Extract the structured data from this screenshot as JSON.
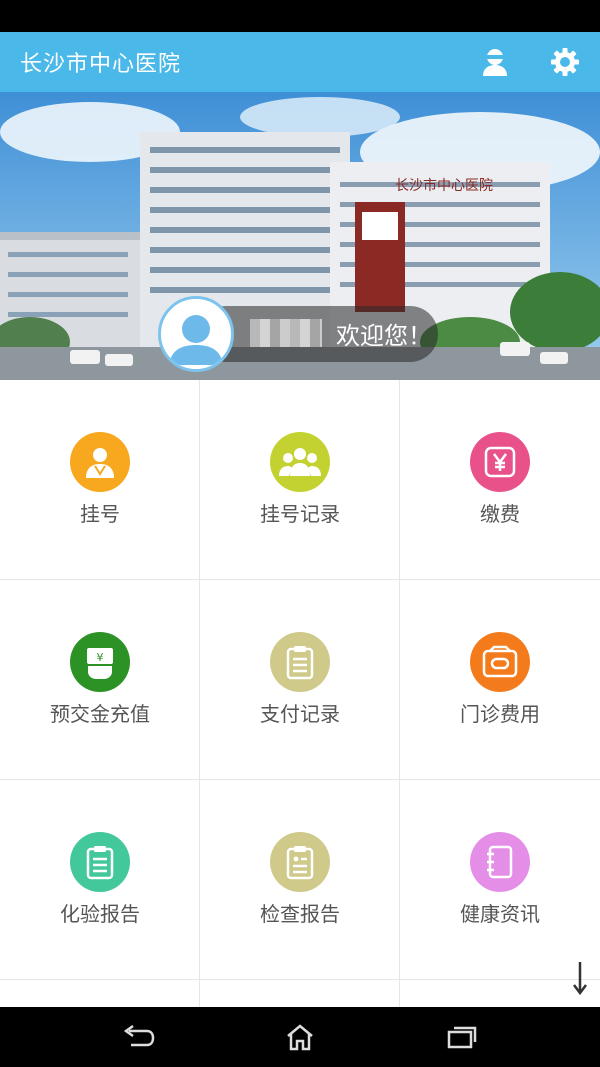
{
  "app_title": "长沙市中心医院",
  "header_icons": {
    "profile": "user-icon",
    "settings": "gear-icon"
  },
  "welcome": {
    "text": "欢迎您！"
  },
  "banner": {
    "sign_text": "长沙市中心医院"
  },
  "menu": [
    {
      "label": "挂号",
      "color": "#f7a81f",
      "icon": "doctor-icon"
    },
    {
      "label": "挂号记录",
      "color": "#c3d230",
      "icon": "group-icon"
    },
    {
      "label": "缴费",
      "color": "#e8518a",
      "icon": "yuan-icon"
    },
    {
      "label": "预交金充值",
      "color": "#2d9226",
      "icon": "cash-hand-icon"
    },
    {
      "label": "支付记录",
      "color": "#cfc98a",
      "icon": "clipboard-icon"
    },
    {
      "label": "门诊费用",
      "color": "#f47b1c",
      "icon": "wallet-icon"
    },
    {
      "label": "化验报告",
      "color": "#43c89b",
      "icon": "report-icon"
    },
    {
      "label": "检查报告",
      "color": "#cfc98a",
      "icon": "report-icon"
    },
    {
      "label": "健康资讯",
      "color": "#e58ee8",
      "icon": "notebook-icon"
    }
  ],
  "colors": {
    "appbar": "#4ab8e8"
  }
}
